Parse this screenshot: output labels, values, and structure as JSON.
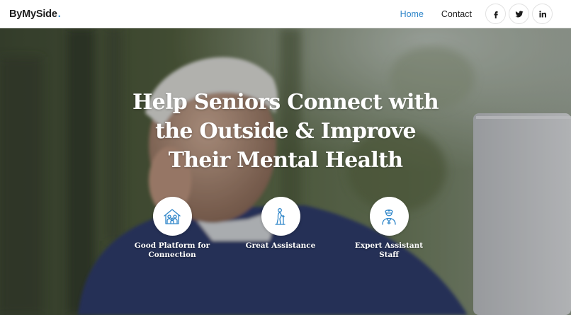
{
  "brand": {
    "name": "ByMySide",
    "dot": "."
  },
  "nav": {
    "home": "Home",
    "contact": "Contact"
  },
  "social": [
    "facebook-icon",
    "twitter-icon",
    "linkedin-icon"
  ],
  "hero": {
    "headline_lines": [
      "Help Seniors Connect with",
      "the Outside & Improve",
      "Their Mental Health"
    ],
    "features": [
      {
        "icon": "family-house-icon",
        "label": "Good Platform for Connection"
      },
      {
        "icon": "walking-cane-icon",
        "label": "Great Assistance"
      },
      {
        "icon": "nurse-icon",
        "label": "Expert Assistant Staff"
      }
    ]
  },
  "colors": {
    "accent": "#2f86c9",
    "text": "#1f1f1f",
    "white": "#ffffff"
  }
}
